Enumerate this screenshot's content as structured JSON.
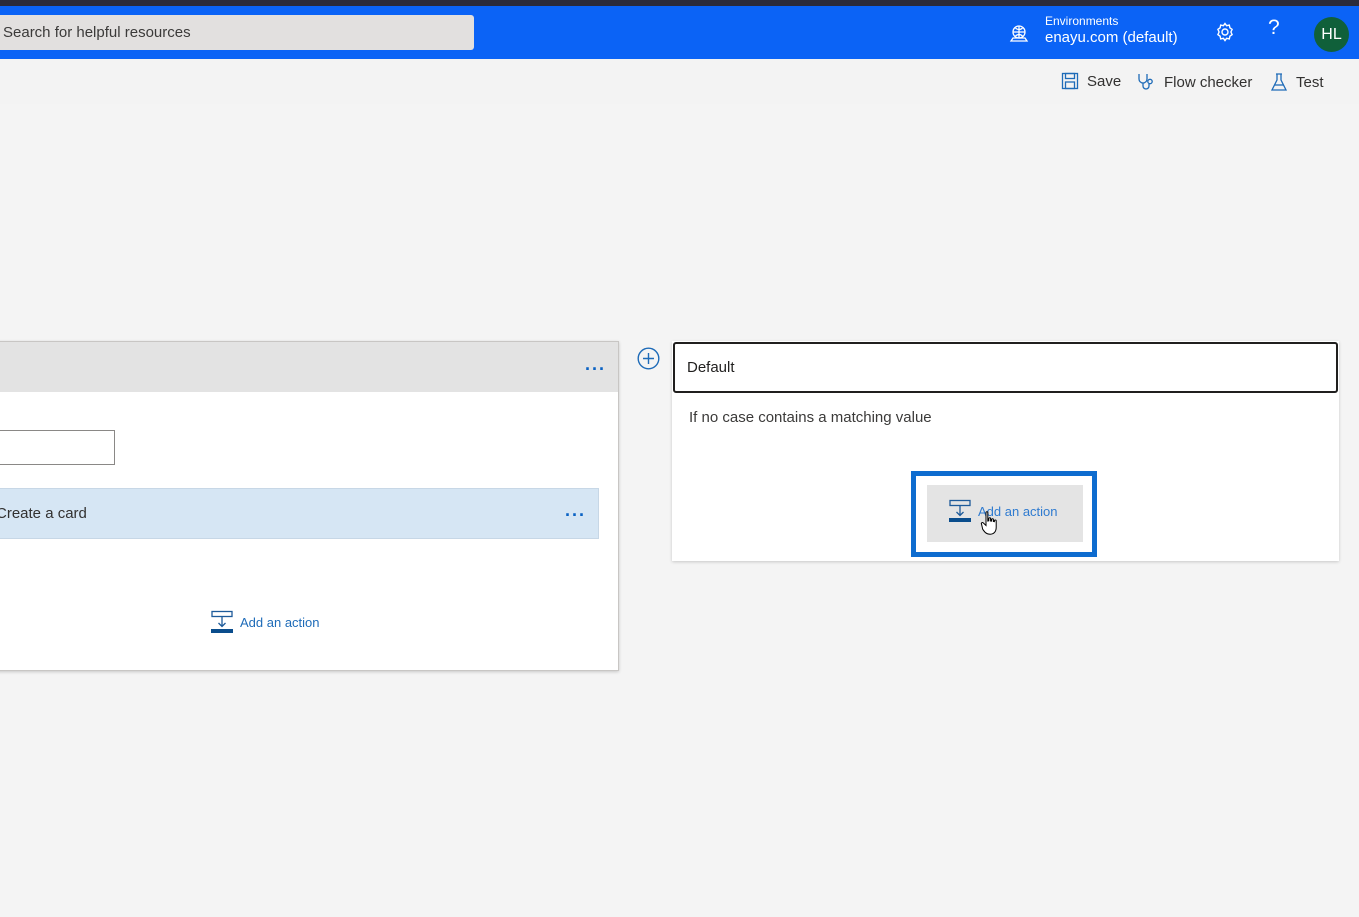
{
  "header": {
    "search_placeholder": "Search for helpful resources",
    "environment_label": "Environments",
    "environment_value": "enayu.com (default)",
    "help_label": "?",
    "avatar_initials": "HL",
    "icons": [
      "environment-icon",
      "settings-icon",
      "help-icon"
    ]
  },
  "toolbar": {
    "save_label": "Save",
    "flow_checker_label": "Flow checker",
    "test_label": "Test"
  },
  "left_card": {
    "more_label": "...",
    "sub_action": {
      "title": "Create a card",
      "more_label": "..."
    },
    "add_action_label": "Add an action"
  },
  "right_card": {
    "title": "Default",
    "description": "If no case contains a matching value",
    "add_action_label": "Add an action"
  },
  "colors": {
    "header_bg": "#0b63f6",
    "accent": "#0e6ccf",
    "avatar_bg": "#10603a",
    "sub_action_bg": "#d6e6f4"
  }
}
